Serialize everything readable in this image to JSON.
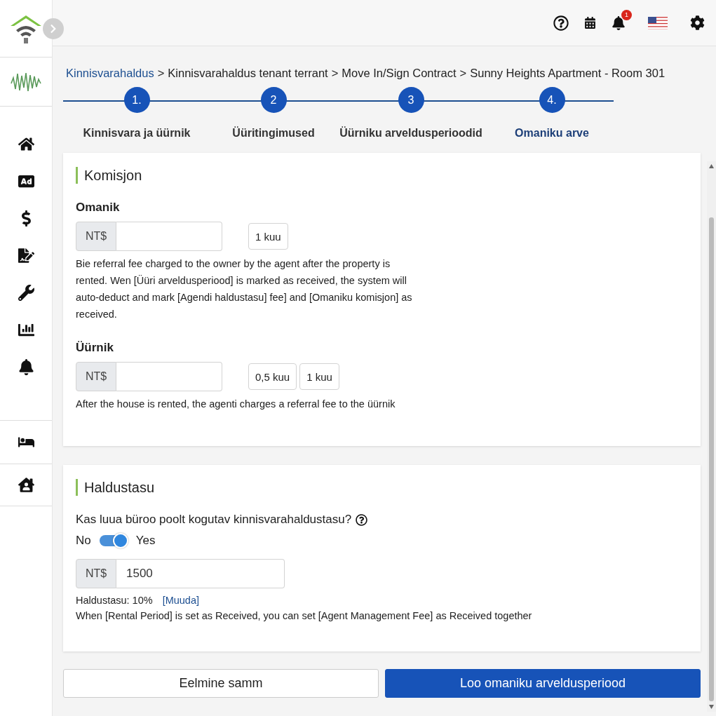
{
  "topbar": {
    "notification_count": "1"
  },
  "breadcrumb": [
    {
      "label": "Kinnisvarahaldus",
      "link": true
    },
    {
      "label": "Kinnisvarahaldus tenant terrant",
      "link": false
    },
    {
      "label": "Move In/Sign Contract",
      "link": false
    },
    {
      "label": "Sunny Heights Apartment - Room 301",
      "link": false
    }
  ],
  "breadcrumb_separator": ">",
  "steps": [
    {
      "number": "1.",
      "label": "Kinnisvara ja üürnik",
      "selected": false
    },
    {
      "number": "2",
      "label": "Üüritingimused",
      "selected": false
    },
    {
      "number": "3",
      "label": "Üürniku arveldusperioodid",
      "selected": false
    },
    {
      "number": "4.",
      "label": "Omaniku arve",
      "selected": true
    }
  ],
  "commission": {
    "title": "Komisjon",
    "groups": [
      {
        "label": "Omanik",
        "prefix": "NT$",
        "options": [
          "1 kuu"
        ],
        "note": "Bie referral fee charged to the owner by the agent after the property is rented. Wen [Üüri arveldusperiood] is marked as received, the system will auto-deduct and mark [Agendi haldustasu] fee] and [Omaniku komisjon] as received."
      },
      {
        "label": "Üürnik",
        "prefix": "NT$",
        "options": [
          "0,5 kuu",
          "1 kuu"
        ],
        "note": "After the house is rented, the agenti charges a referral fee to the üürnik"
      }
    ]
  },
  "management_fee": {
    "title": "Haldustasu",
    "question": "Kas luua büroo poolt kogutav kinnisvarahaldustasu?",
    "toggle": {
      "off_label": "No",
      "on_label": "Yes",
      "on": true
    },
    "prefix": "NT$",
    "value": "1500",
    "rate": "Haldustasu: 10%",
    "edit_link": "[Muuda]",
    "note": "When [Rental Period] is set as Received, you can set [Agent Management Fee] as Received together"
  },
  "buttons": [
    {
      "label": "Eelmine samm",
      "kind": "secondary"
    },
    {
      "label": "Loo omaniku arveldusperiood",
      "kind": "primary"
    }
  ]
}
